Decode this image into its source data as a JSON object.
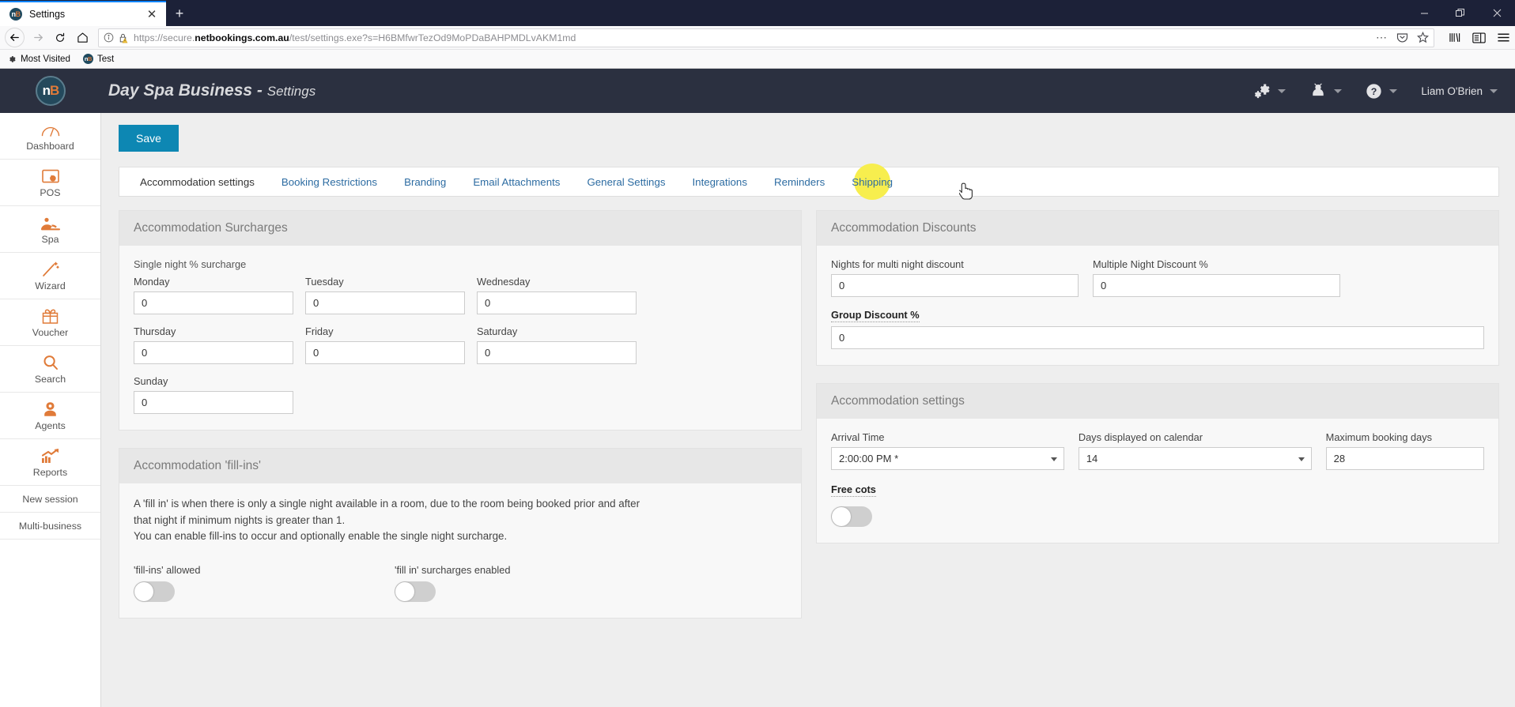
{
  "browser": {
    "tab_title": "Settings",
    "tab_favicon_text": "nB",
    "new_tab_label": "+",
    "close_tab_label": "✕",
    "window_minimize": "—",
    "window_restore": "❐",
    "window_close": "✕",
    "url": "https://secure.netbookings.com.au/test/settings.exe?s=H6BMfwrTezOd9MoPDaBAHPMDLvAKM1md",
    "url_scheme": "https://secure.",
    "url_domain": "netbookings.com.au",
    "url_path": "/test/settings.exe?s=H6BMfwrTezOd9MoPDaBAHPMDLvAKM1md",
    "bookmarks": [
      {
        "label": "Most Visited",
        "icon": "gear-icon"
      },
      {
        "label": "Test",
        "icon": "netbookings-favicon"
      }
    ]
  },
  "appheader": {
    "logo_text": "nB",
    "business_name": "Day Spa Business",
    "section_separator": " - ",
    "section_name": "Settings",
    "user_name": "Liam O'Brien",
    "icons": [
      "gears-icon",
      "user-settings-icon",
      "help-icon"
    ]
  },
  "sidebar": {
    "items": [
      {
        "label": "Dashboard",
        "icon": "dashboard-icon"
      },
      {
        "label": "POS",
        "icon": "pos-icon"
      },
      {
        "label": "Spa",
        "icon": "spa-icon"
      },
      {
        "label": "Wizard",
        "icon": "wizard-icon"
      },
      {
        "label": "Voucher",
        "icon": "voucher-icon"
      },
      {
        "label": "Search",
        "icon": "search-icon"
      },
      {
        "label": "Agents",
        "icon": "agents-icon"
      },
      {
        "label": "Reports",
        "icon": "reports-icon"
      }
    ],
    "text_items": [
      {
        "label": "New session"
      },
      {
        "label": "Multi-business"
      }
    ]
  },
  "toolbar": {
    "save_label": "Save"
  },
  "tabs": [
    {
      "label": "Accommodation settings",
      "active": true
    },
    {
      "label": "Booking Restrictions",
      "active": false
    },
    {
      "label": "Branding",
      "active": false
    },
    {
      "label": "Email Attachments",
      "active": false
    },
    {
      "label": "General Settings",
      "active": false
    },
    {
      "label": "Integrations",
      "active": false
    },
    {
      "label": "Reminders",
      "active": false
    },
    {
      "label": "Shipping",
      "active": false,
      "highlighted": true
    }
  ],
  "surcharges": {
    "title": "Accommodation Surcharges",
    "group_label": "Single night % surcharge",
    "days": [
      {
        "label": "Monday",
        "value": "0"
      },
      {
        "label": "Tuesday",
        "value": "0"
      },
      {
        "label": "Wednesday",
        "value": "0"
      },
      {
        "label": "Thursday",
        "value": "0"
      },
      {
        "label": "Friday",
        "value": "0"
      },
      {
        "label": "Saturday",
        "value": "0"
      },
      {
        "label": "Sunday",
        "value": "0"
      }
    ]
  },
  "fillins": {
    "title": "Accommodation 'fill-ins'",
    "paragraph_line1": "A 'fill in' is when there is only a single night available in a room, due to the room being booked prior and after",
    "paragraph_line2": "that night if minimum nights is greater than 1.",
    "paragraph_line3": "You can enable fill-ins to occur and optionally enable the single night surcharge.",
    "toggle_allowed_label": "'fill-ins' allowed",
    "toggle_allowed_state": "off",
    "toggle_surcharges_label": "'fill in' surcharges enabled",
    "toggle_surcharges_state": "off"
  },
  "discounts": {
    "title": "Accommodation Discounts",
    "nights_label": "Nights for multi night discount",
    "nights_value": "0",
    "multi_label": "Multiple Night Discount %",
    "multi_value": "0",
    "group_label": "Group Discount %",
    "group_value": "0"
  },
  "accommodation_settings": {
    "title": "Accommodation settings",
    "arrival_time_label": "Arrival Time",
    "arrival_time_value": "2:00:00 PM *",
    "days_displayed_label": "Days displayed on calendar",
    "days_displayed_value": "14",
    "max_booking_label": "Maximum booking days",
    "max_booking_value": "28",
    "free_cots_label": "Free cots",
    "free_cots_state": "off"
  },
  "colors": {
    "header_bg": "#2b3040",
    "accent_orange": "#e07b39",
    "save_blue": "#0d87b3",
    "link_blue": "#2d6ca2",
    "highlight_yellow": "#f7ee4e",
    "panel_bg": "#f8f8f8",
    "panel_head_bg": "#e7e7e7",
    "content_bg": "#eeeeee"
  }
}
